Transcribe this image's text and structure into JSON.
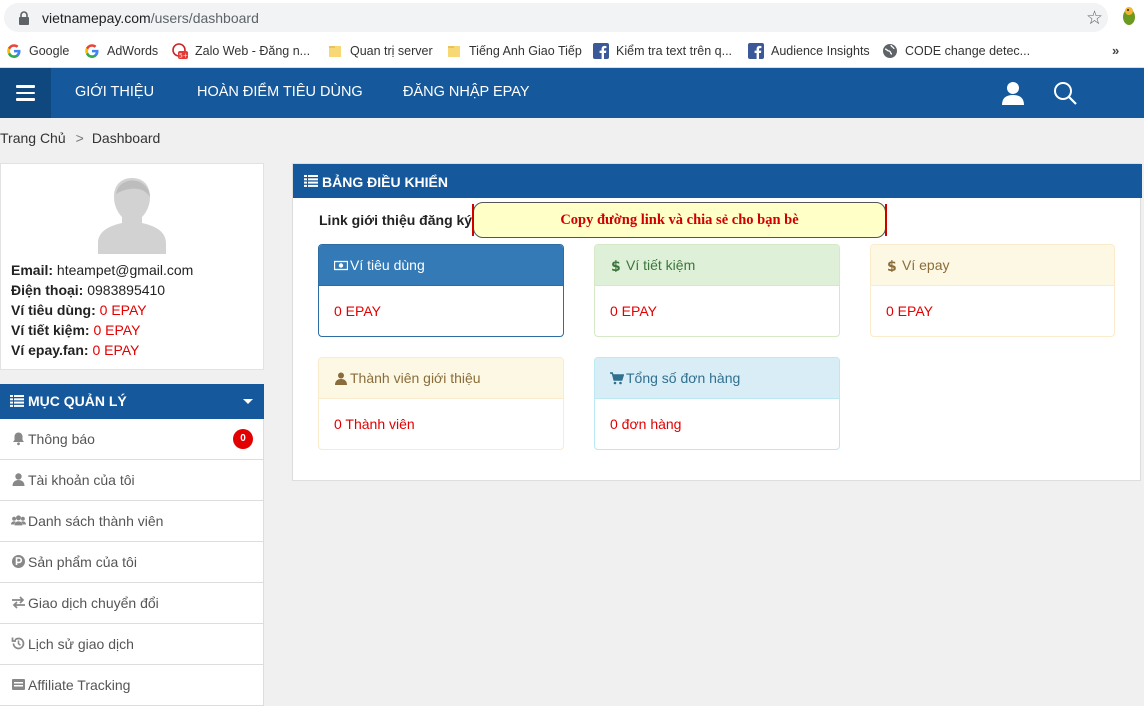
{
  "browser": {
    "url_host": "vietnamepay.com",
    "url_path": "/users/dashboard",
    "bookmarks": [
      {
        "label": "Google",
        "icon": "google-icon"
      },
      {
        "label": "AdWords",
        "icon": "google-icon"
      },
      {
        "label": "Zalo Web - Đăng n...",
        "icon": "zalo-icon"
      },
      {
        "label": "Quan trị server",
        "icon": "folder-icon"
      },
      {
        "label": "Tiếng Anh Giao Tiếp",
        "icon": "folder-icon"
      },
      {
        "label": "Kiểm tra text trên q...",
        "icon": "facebook-icon"
      },
      {
        "label": "Audience Insights",
        "icon": "facebook-icon"
      },
      {
        "label": "CODE change detec...",
        "icon": "globe-icon"
      }
    ],
    "more_label": "»"
  },
  "nav": {
    "links": [
      "GIỚI THIỆU",
      "HOÀN ĐIỂM TIÊU DÙNG",
      "ĐĂNG NHẬP EPAY"
    ]
  },
  "breadcrumb": {
    "home": "Trang Chủ",
    "sep": ">",
    "current": "Dashboard"
  },
  "profile": {
    "email_label": "Email:",
    "email": "hteampet@gmail.com",
    "phone_label": "Điện thoại:",
    "phone": "0983895410",
    "wallet_spend_label": "Ví tiêu dùng:",
    "wallet_spend": "0 EPAY",
    "wallet_save_label": "Ví tiết kiệm:",
    "wallet_save": "0 EPAY",
    "wallet_fan_label": "Ví epay.fan:",
    "wallet_fan": "0 EPAY"
  },
  "menu": {
    "title": "MỤC QUẢN LÝ",
    "items": [
      {
        "label": "Thông báo",
        "icon": "bell-icon",
        "badge": "0"
      },
      {
        "label": "Tài khoản của tôi",
        "icon": "user-icon"
      },
      {
        "label": "Danh sách thành viên",
        "icon": "users-icon"
      },
      {
        "label": "Sản phẩm của tôi",
        "icon": "product-p-icon"
      },
      {
        "label": "Giao dịch chuyển đổi",
        "icon": "exchange-icon"
      },
      {
        "label": "Lịch sử giao dịch",
        "icon": "history-icon"
      },
      {
        "label": "Affiliate Tracking",
        "icon": "tracking-icon"
      }
    ]
  },
  "dashboard": {
    "title": "BẢNG ĐIỀU KHIỂN",
    "ref_label": "Link giới thiệu đăng ký",
    "copy_button": "Copy đường link và chia sẻ cho bạn bè",
    "cards": [
      {
        "title": "Ví tiêu dùng",
        "value": "0 EPAY",
        "icon": "money-icon",
        "style": "primary",
        "color": "#337ab7"
      },
      {
        "title": "Ví tiết kiệm",
        "value": "0 EPAY",
        "icon": "dollar-icon",
        "style": "success",
        "color": "#dff0d8"
      },
      {
        "title": "Ví epay",
        "value": "0 EPAY",
        "icon": "dollar-icon",
        "style": "warning",
        "color": "#fcf8e3"
      },
      {
        "title": "Thành viên giới thiệu",
        "value": "0 Thành viên",
        "icon": "user-icon",
        "style": "warning",
        "color": "#fcf8e3"
      },
      {
        "title": "Tổng số đơn hàng",
        "value": "0 đơn hàng",
        "icon": "cart-icon",
        "style": "info",
        "color": "#d9edf7"
      }
    ]
  },
  "colors": {
    "brand_blue": "#15589b",
    "value_red": "#e30000",
    "copy_bg": "#ffffc8"
  }
}
